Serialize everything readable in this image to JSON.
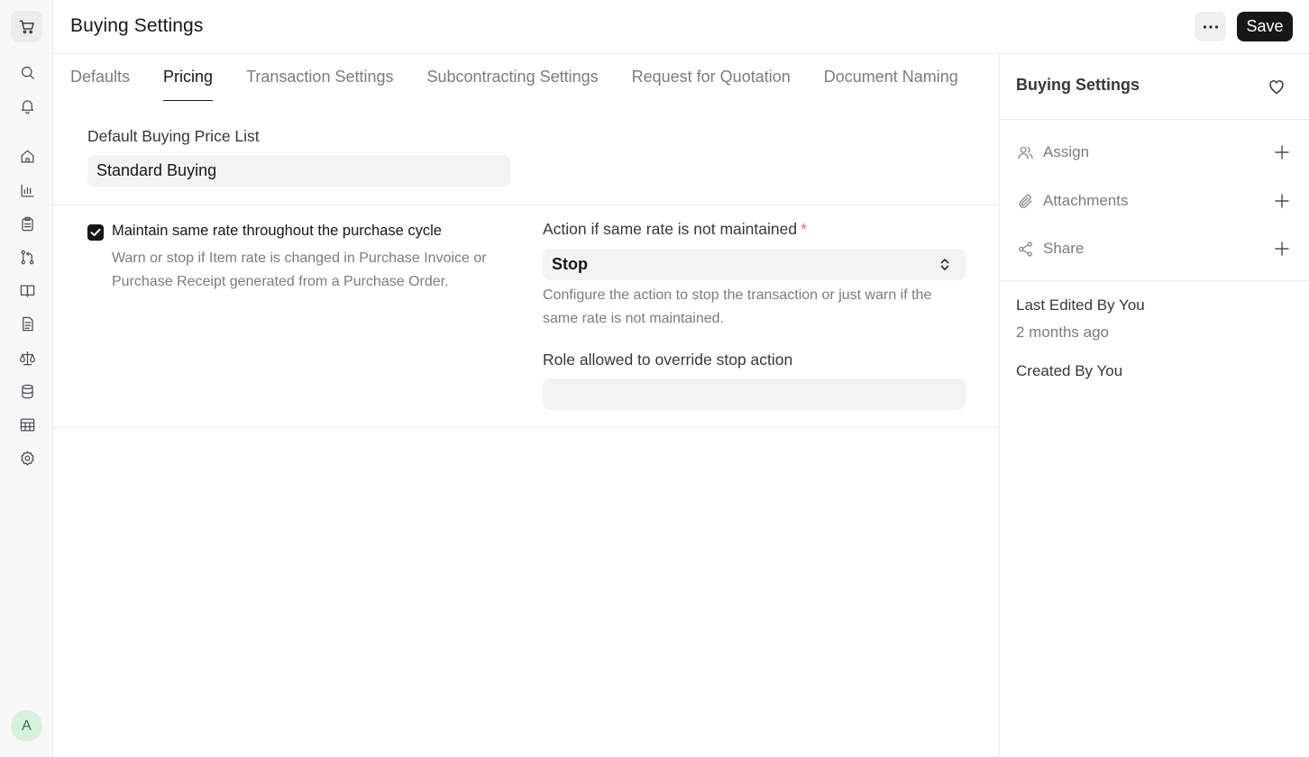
{
  "app": {
    "title": "Buying Settings"
  },
  "header": {
    "more_label": "···",
    "save_label": "Save"
  },
  "rail": {
    "avatar_initial": "A",
    "icons": [
      "cart-icon",
      "search-icon",
      "bell-icon",
      "home-icon",
      "chart-icon",
      "clipboard-icon",
      "branches-icon",
      "book-icon",
      "document-icon",
      "scale-icon",
      "database-icon",
      "table-icon",
      "gear-icon"
    ]
  },
  "tabs": [
    {
      "label": "Defaults",
      "active": false
    },
    {
      "label": "Pricing",
      "active": true
    },
    {
      "label": "Transaction Settings",
      "active": false
    },
    {
      "label": "Subcontracting Settings",
      "active": false
    },
    {
      "label": "Request for Quotation",
      "active": false
    },
    {
      "label": "Document Naming",
      "active": false
    }
  ],
  "form": {
    "price_list": {
      "label": "Default Buying Price List",
      "value": "Standard Buying"
    },
    "maintain_rate": {
      "checked": true,
      "label": "Maintain same rate throughout the purchase cycle",
      "description": "Warn or stop if Item rate is changed in Purchase Invoice or Purchase Receipt generated from a Purchase Order."
    },
    "action": {
      "label": "Action if same rate is not maintained",
      "required_mark": "*",
      "value": "Stop",
      "description": "Configure the action to stop the transaction or just warn if the same rate is not maintained."
    },
    "role_override": {
      "label": "Role allowed to override stop action",
      "value": ""
    }
  },
  "sidebar": {
    "title": "Buying Settings",
    "actions": [
      {
        "label": "Assign",
        "icon": "users-icon"
      },
      {
        "label": "Attachments",
        "icon": "paperclip-icon"
      },
      {
        "label": "Share",
        "icon": "share-icon"
      }
    ],
    "last_edited": "Last Edited By You",
    "last_edited_time": "2 months ago",
    "created": "Created By You"
  },
  "colors": {
    "primary": "#171717",
    "muted_text": "#7c7c7c",
    "field_bg": "#f3f3f3",
    "avatar_bg": "#d6f1dd"
  }
}
